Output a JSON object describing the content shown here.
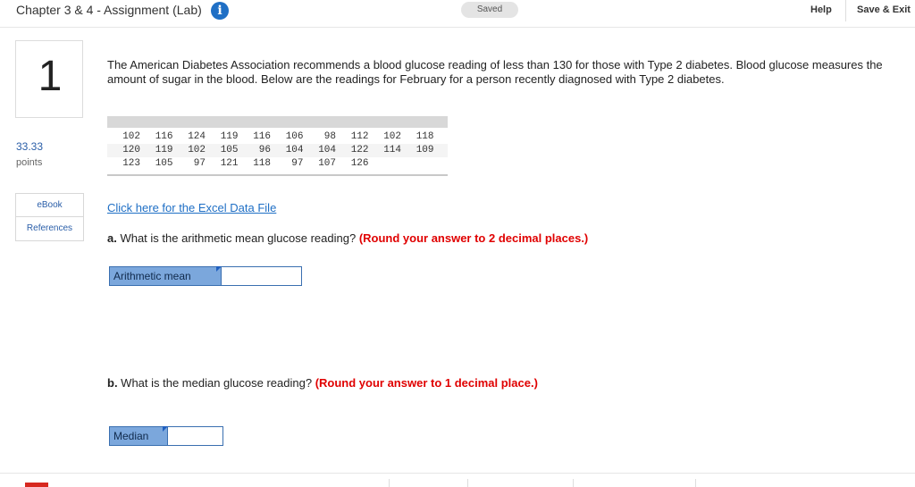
{
  "header": {
    "title": "Chapter 3 & 4 - Assignment (Lab)",
    "info_icon": "i",
    "saved_label": "Saved",
    "help_label": "Help",
    "save_exit_label": "Save & Exit"
  },
  "sidebar": {
    "question_number": "1",
    "points_value": "33.33",
    "points_label": "points",
    "ebook_label": "eBook",
    "references_label": "References"
  },
  "question": {
    "prompt": "The American Diabetes Association recommends a blood glucose reading of less than 130 for those with Type 2 diabetes. Blood glucose measures the amount of sugar in the blood. Below are the readings for February for a person recently diagnosed with Type 2 diabetes.",
    "readings": [
      [
        "102",
        "116",
        "124",
        "119",
        "116",
        "106",
        "98",
        "112",
        "102",
        "118"
      ],
      [
        "120",
        "119",
        "102",
        "105",
        "96",
        "104",
        "104",
        "122",
        "114",
        "109"
      ],
      [
        "123",
        "105",
        "97",
        "121",
        "118",
        "97",
        "107",
        "126",
        "",
        ""
      ]
    ],
    "excel_link": "Click here for the Excel Data File",
    "part_a": {
      "letter": "a.",
      "text": " What is the arithmetic mean glucose reading? ",
      "instruction": "(Round your answer to 2 decimal places.)",
      "label": "Arithmetic mean",
      "value": ""
    },
    "part_b": {
      "letter": "b.",
      "text": " What is the median glucose reading? ",
      "instruction": "(Round your answer to 1 decimal place.)",
      "label": "Median",
      "value": ""
    }
  },
  "icons": [
    "info-icon",
    "flag-icon"
  ],
  "colors": {
    "accent": "#1f6fc5",
    "instruction_red": "#e00000",
    "answer_label_bg": "#7ba7dc"
  }
}
